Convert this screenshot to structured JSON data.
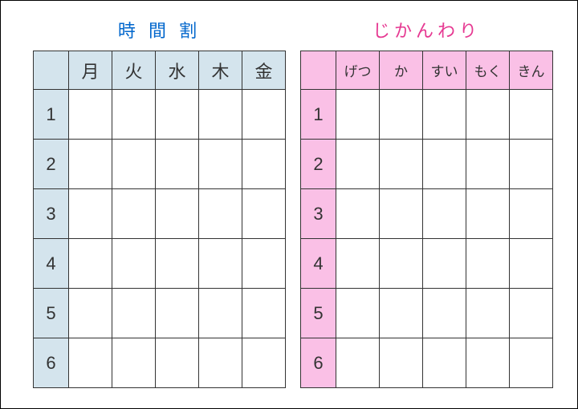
{
  "left": {
    "title": "時 間 割",
    "days": [
      "月",
      "火",
      "水",
      "木",
      "金"
    ],
    "periods": [
      "1",
      "2",
      "3",
      "4",
      "5",
      "6"
    ]
  },
  "right": {
    "title": "じかんわり",
    "days": [
      "げつ",
      "か",
      "すい",
      "もく",
      "きん"
    ],
    "periods": [
      "1",
      "2",
      "3",
      "4",
      "5",
      "6"
    ]
  }
}
